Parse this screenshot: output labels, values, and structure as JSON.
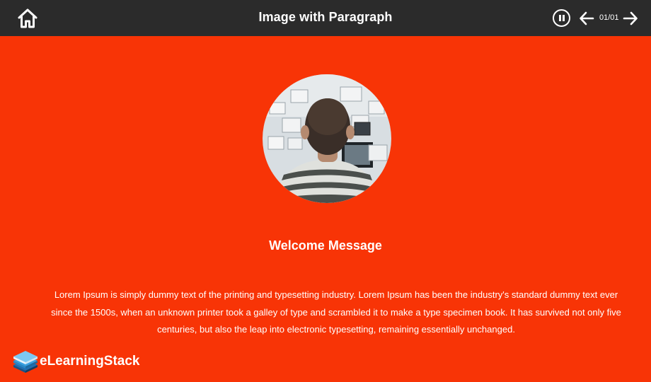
{
  "header": {
    "title": "Image with Paragraph",
    "page_counter": "01/01",
    "icons": {
      "home": "home-icon",
      "pause": "pause-icon",
      "prev": "arrow-left-icon",
      "next": "arrow-right-icon"
    }
  },
  "content": {
    "heading": "Welcome Message",
    "paragraph": "Lorem Ipsum is simply dummy text of the printing and typesetting industry. Lorem Ipsum has been the industry's standard dummy text ever since the 1500s, when an unknown printer took a galley of type and scrambled it to make a type specimen book. It has survived not only five centuries, but also the leap into electronic typesetting, remaining essentially unchanged."
  },
  "footer": {
    "brand": "eLearningStack"
  },
  "colors": {
    "background": "#f83406",
    "header_bar": "#2b2b2b",
    "text": "#ffffff"
  }
}
